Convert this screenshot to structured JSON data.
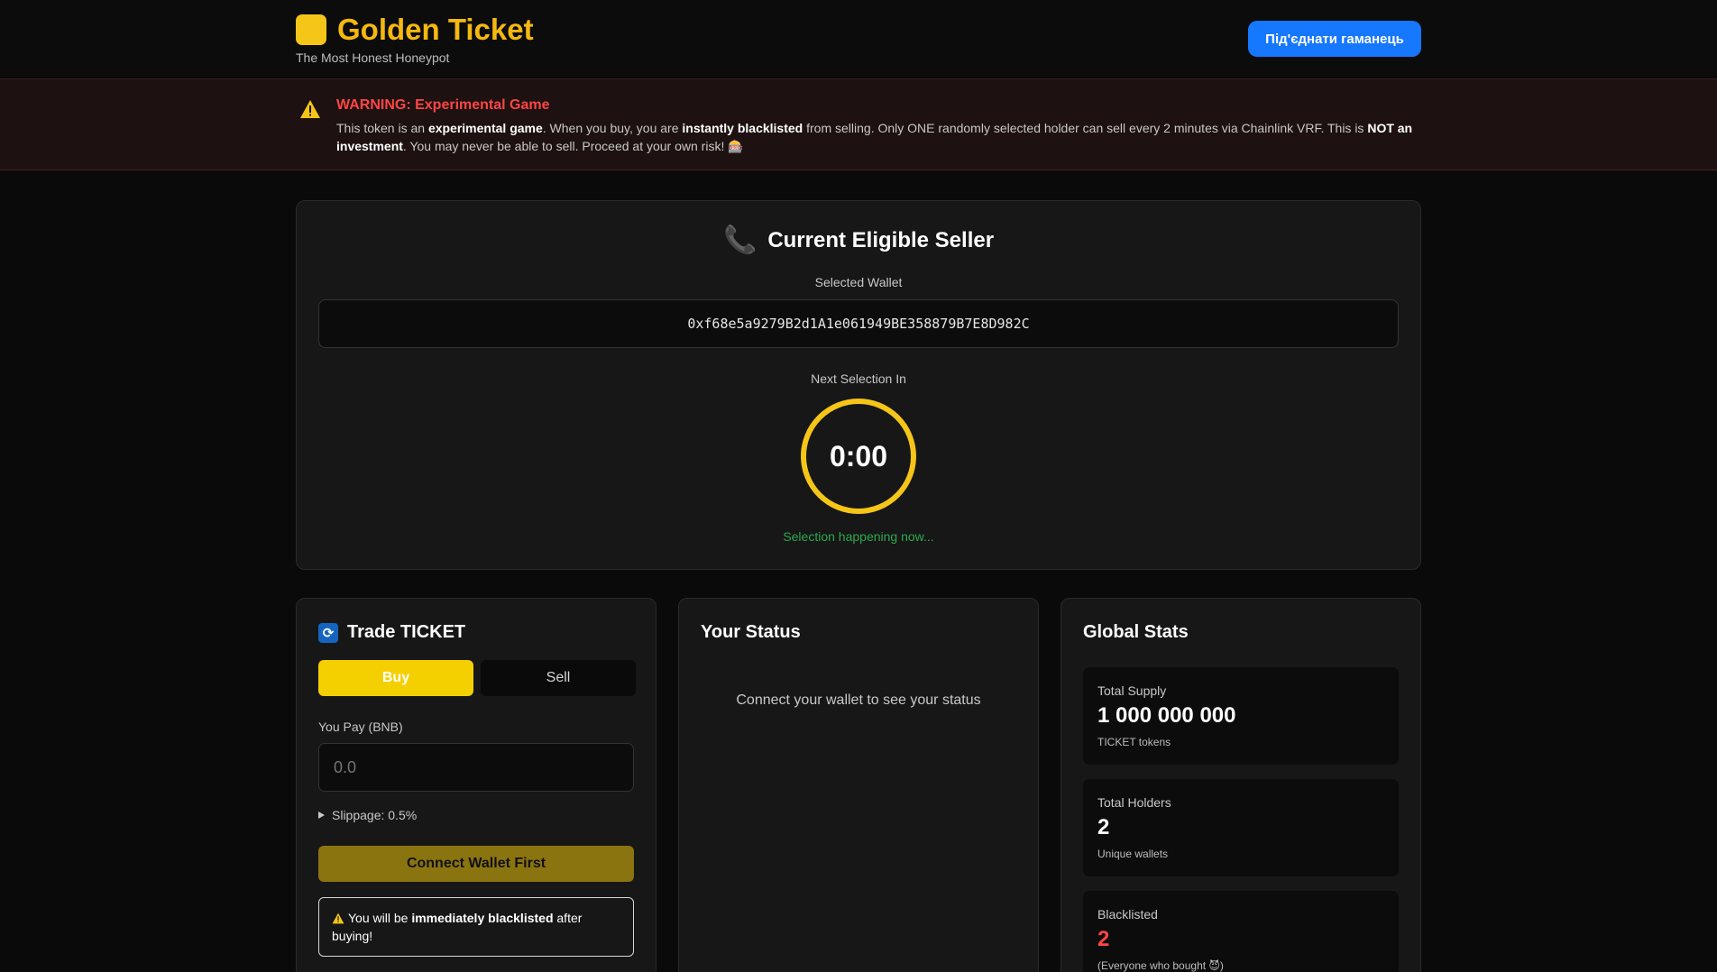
{
  "header": {
    "title": "Golden Ticket",
    "subtitle": "The Most Honest Honeypot",
    "connect_label": "Під'єднати гаманець"
  },
  "warning": {
    "title": "WARNING: Experimental Game",
    "text_1": "This token is an ",
    "bold_1": "experimental game",
    "text_2": ". When you buy, you are ",
    "bold_2": "instantly blacklisted",
    "text_3": " from selling. Only ONE randomly selected holder can sell every 2 minutes via Chainlink VRF. This is ",
    "bold_3": "NOT an investment",
    "text_4": ". You may never be able to sell. Proceed at your own risk! 🎰"
  },
  "seller": {
    "title": "Current Eligible Seller",
    "selected_label": "Selected Wallet",
    "wallet": "0xf68e5a9279B2d1A1e061949BE358879B7E8D982C",
    "next_label": "Next Selection In",
    "timer": "0:00",
    "status": "Selection happening now..."
  },
  "trade": {
    "title": "Trade TICKET",
    "buy_label": "Buy",
    "sell_label": "Sell",
    "pay_label": "You Pay (BNB)",
    "pay_placeholder": "0.0",
    "slippage": "Slippage: 0.5%",
    "connect_first": "Connect Wallet First",
    "note_1": "You will be ",
    "note_bold": "immediately blacklisted",
    "note_2": " after buying!"
  },
  "your_status": {
    "title": "Your Status",
    "message": "Connect your wallet to see your status"
  },
  "global_stats": {
    "title": "Global Stats",
    "total_supply_label": "Total Supply",
    "total_supply_value": "1 000 000 000",
    "total_supply_sub": "TICKET tokens",
    "holders_label": "Total Holders",
    "holders_value": "2",
    "holders_sub": "Unique wallets",
    "blacklisted_label": "Blacklisted",
    "blacklisted_value": "2",
    "blacklisted_sub": "(Everyone who bought 😈)"
  },
  "colors": {
    "accent_gold": "#f5b80f",
    "brand_blue": "#1677ff",
    "danger_red": "#ff4545",
    "success_green": "#2ea84e"
  },
  "icons": {
    "logo": "ticket-logo-icon",
    "warning": "warning-icon",
    "phone": "phone-icon",
    "trade": "sync-icon",
    "slippage_toggle": "triangle-right-icon"
  }
}
